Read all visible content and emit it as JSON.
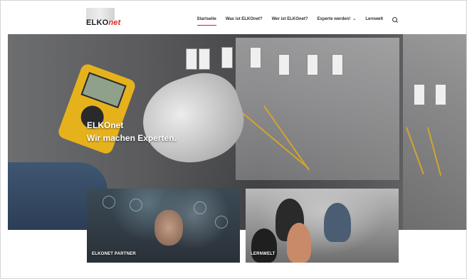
{
  "header": {
    "logo": {
      "text_main": "ELKO",
      "text_accent": "net"
    },
    "nav": [
      {
        "label": "Startseite",
        "active": true
      },
      {
        "label": "Was ist ELKOnet?"
      },
      {
        "label": "Wer ist ELKOnet?"
      },
      {
        "label": "Experte werden!",
        "dropdown": true
      },
      {
        "label": "Lernwelt"
      }
    ],
    "search_icon": "search-icon"
  },
  "hero": {
    "title": "ELKOnet",
    "subtitle": "Wir machen Experten."
  },
  "cards": [
    {
      "label": "ELKONET PARTNER"
    },
    {
      "label": "LERNWELT"
    }
  ],
  "colors": {
    "accent": "#d5241c",
    "text": "#2d2d2d"
  }
}
